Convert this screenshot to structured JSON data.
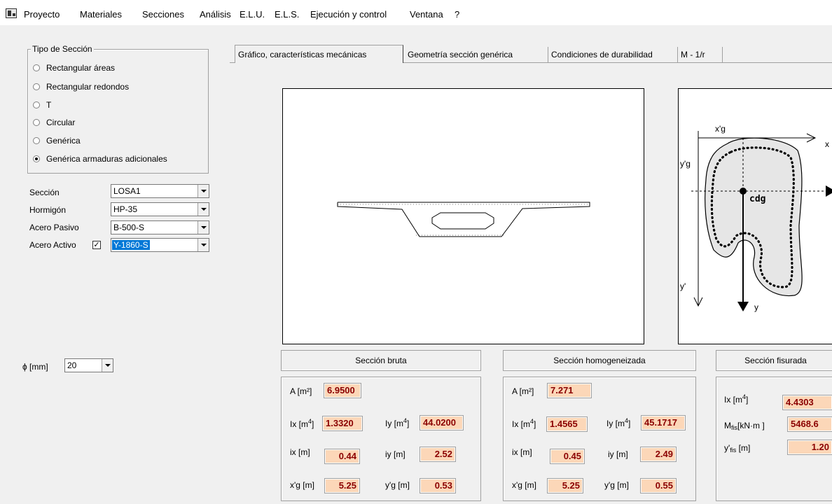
{
  "menu": [
    "Proyecto",
    "Materiales",
    "Secciones",
    "Análisis",
    "E.L.U.",
    "E.L.S.",
    "Ejecución y control",
    "Ventana",
    "?"
  ],
  "tipo_seccion": {
    "title": "Tipo de Sección",
    "options": [
      "Rectangular áreas",
      "Rectangular redondos",
      "T",
      "Circular",
      "Genérica",
      "Genérica armaduras adicionales"
    ],
    "selected": "Genérica armaduras adicionales"
  },
  "fields": {
    "seccion": {
      "label": "Sección",
      "value": "LOSA1"
    },
    "hormigon": {
      "label": "Hormigón",
      "value": "HP-35"
    },
    "acero_pasivo": {
      "label": "Acero Pasivo",
      "value": "B-500-S"
    },
    "acero_activo": {
      "label": "Acero Activo",
      "value": "Y-1860-S",
      "checked": true
    }
  },
  "phi": {
    "label": "ϕ [mm]",
    "value": "20"
  },
  "tabs": [
    "Gráfico, características mecánicas",
    "Geometría sección genérica",
    "Condiciones de durabilidad",
    "M - 1/r"
  ],
  "active_tab": "Gráfico, características mecánicas",
  "diagram": {
    "x_g": "x'g",
    "y_g": "y'g",
    "y_prime": "y'",
    "x": "x",
    "y": "y",
    "cdg": "cdg"
  },
  "seccion_bruta": {
    "title": "Sección bruta",
    "A": "6.9500",
    "Ix": "1.3320",
    "Iy": "44.0200",
    "ix": "0.44",
    "iy": "2.52",
    "xg": "5.25",
    "yg": "0.53"
  },
  "seccion_homogeneizada": {
    "title": "Sección homogeneizada",
    "A": "7.271",
    "Ix": "1.4565",
    "Iy": "45.1717",
    "ix": "0.45",
    "iy": "2.49",
    "xg": "5.25",
    "yg": "0.55"
  },
  "seccion_fisurada": {
    "title": "Sección fisurada",
    "Ix": "4.4303",
    "Mfis": "5468.6",
    "yfis": "1.20"
  },
  "labels": {
    "A": "A [m²]",
    "Ix": "Ix [m",
    "Iy": "Iy  [m",
    "ix": "ix [m]",
    "iy": "iy [m]",
    "xg": "x'g [m]",
    "yg": "y'g [m]",
    "m4close": "]",
    "Mfis": "M",
    "Mfis_sub": "fis",
    "Mfis_unit": "[kN·m ]",
    "yfis": "y'",
    "yfis_sub": "fis",
    "yfis_unit": " [m]"
  }
}
